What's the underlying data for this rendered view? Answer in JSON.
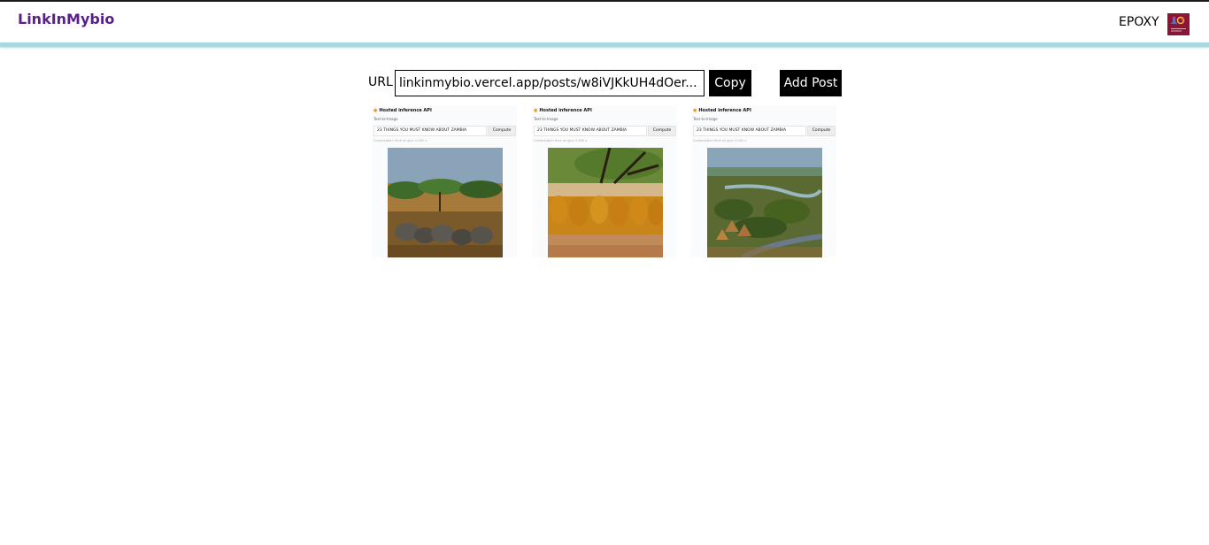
{
  "header": {
    "brand": "LinkInMybio",
    "username": "EPOXY"
  },
  "toolbar": {
    "url_label": "URL",
    "url_value": "linkinmybio.vercel.app/posts/w8iVJKkUH4dOer...",
    "copy_label": "Copy",
    "add_label": "Add Post"
  },
  "posts": [
    {
      "head": "Hosted inference API",
      "sub": "Text-to-Image",
      "prompt": "23 THINGS YOU MUST KNOW ABOUT ZAMBIA",
      "compute": "Compute",
      "meta": "Computation time on gpu: 0.000 s"
    },
    {
      "head": "Hosted inference API",
      "sub": "Text-to-Image",
      "prompt": "23 THINGS YOU MUST KNOW ABOUT ZAMBIA",
      "compute": "Compute",
      "meta": "Computation time on gpu: 0.000 s"
    },
    {
      "head": "Hosted inference API",
      "sub": "Text-to-Image",
      "prompt": "23 THINGS YOU MUST KNOW ABOUT ZAMBIA",
      "compute": "Compute",
      "meta": "Computation time on gpu: 0.000 s"
    }
  ],
  "colors": {
    "brand": "#5b1f8a",
    "header_border": "#a8d8e0",
    "button_bg": "#000000",
    "avatar_bg": "#8a1535"
  }
}
